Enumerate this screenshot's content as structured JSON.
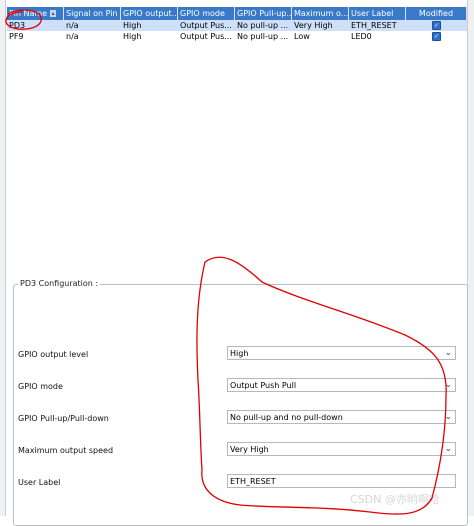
{
  "table": {
    "headers": [
      "Pin Name",
      "Signal on Pin",
      "GPIO output...",
      "GPIO mode",
      "GPIO Pull-up...",
      "Maximum o...",
      "User Label",
      "Modified"
    ],
    "rows": [
      {
        "cells": [
          "PD3",
          "n/a",
          "High",
          "Output Pus...",
          "No pull-up ...",
          "Very High",
          "ETH_RESET"
        ],
        "modified": true,
        "selected": true
      },
      {
        "cells": [
          "PF9",
          "n/a",
          "High",
          "Output Pus...",
          "No pull-up ...",
          "Low",
          "LED0"
        ],
        "modified": true,
        "selected": false
      }
    ]
  },
  "config": {
    "title": "PD3 Configuration :",
    "fields": [
      {
        "label": "GPIO output level",
        "value": "High",
        "type": "select"
      },
      {
        "label": "GPIO mode",
        "value": "Output Push Pull",
        "type": "select"
      },
      {
        "label": "GPIO Pull-up/Pull-down",
        "value": "No pull-up and no pull-down",
        "type": "select"
      },
      {
        "label": "Maximum output speed",
        "value": "Very High",
        "type": "select"
      },
      {
        "label": "User Label",
        "value": "ETH_RESET",
        "type": "text"
      }
    ]
  },
  "watermark": "CSDN @亦哟啊哈",
  "colors": {
    "header": "#3a79c8",
    "selected_row": "#cde0f7",
    "annotation": "#e00000"
  }
}
